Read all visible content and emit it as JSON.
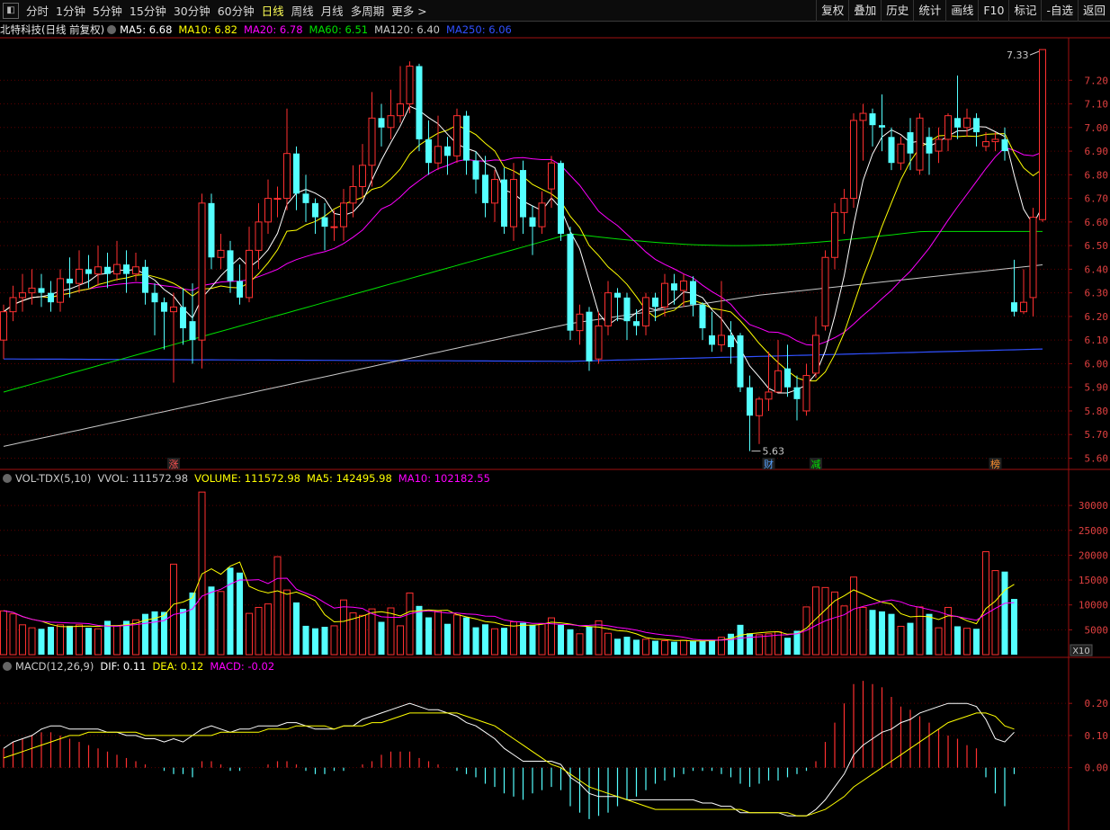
{
  "toolbar": {
    "timeframes": [
      "分时",
      "1分钟",
      "5分钟",
      "15分钟",
      "30分钟",
      "60分钟",
      "日线",
      "周线",
      "月线",
      "多周期",
      "更多 >"
    ],
    "active_index": 6,
    "tools": [
      "复权",
      "叠加",
      "历史",
      "统计",
      "画线",
      "F10",
      "标记",
      "-自选",
      "返回"
    ]
  },
  "legend": {
    "title": "北特科技(日线 前复权)",
    "items": [
      {
        "label": "MA5: 6.68",
        "color": "#ffffff"
      },
      {
        "label": "MA10: 6.82",
        "color": "#ffff00"
      },
      {
        "label": "MA20: 6.78",
        "color": "#ff00ff"
      },
      {
        "label": "MA60: 6.51",
        "color": "#00e000"
      },
      {
        "label": "MA120: 6.40",
        "color": "#c8c8c8"
      },
      {
        "label": "MA250: 6.06",
        "color": "#3050ff"
      }
    ]
  },
  "vol_legend": {
    "items": [
      {
        "label": "VOL-TDX(5,10)",
        "color": "#c8c8c8"
      },
      {
        "label": "VVOL: 111572.98",
        "color": "#c8c8c8"
      },
      {
        "label": "VOLUME: 111572.98",
        "color": "#ffff00"
      },
      {
        "label": "MA5: 142495.98",
        "color": "#ffff00"
      },
      {
        "label": "MA10: 102182.55",
        "color": "#ff00ff"
      }
    ],
    "unit_badge": "X10"
  },
  "macd_legend": {
    "items": [
      {
        "label": "MACD(12,26,9)",
        "color": "#c8c8c8"
      },
      {
        "label": "DIF: 0.11",
        "color": "#ffffff"
      },
      {
        "label": "DEA: 0.12",
        "color": "#ffff00"
      },
      {
        "label": "MACD: -0.02",
        "color": "#ff00ff"
      }
    ]
  },
  "annotations": {
    "high": "7.33",
    "low": "5.63",
    "events": [
      "涨",
      "财",
      "减",
      "榜"
    ]
  },
  "colors": {
    "up": "#ff3030",
    "down": "#54ffff",
    "axis": "#a01010",
    "grid": "#5a0000"
  },
  "chart_data": [
    {
      "type": "candlestick",
      "name": "price",
      "yticks": [
        7.2,
        7.1,
        7.0,
        6.9,
        6.8,
        6.7,
        6.6,
        6.5,
        6.4,
        6.3,
        6.2,
        6.1,
        6.0,
        5.9,
        5.8,
        5.7,
        5.6
      ],
      "ylim": [
        5.56,
        7.38
      ],
      "candles": [
        [
          6.1,
          6.22,
          6.25,
          6.02
        ],
        [
          6.22,
          6.28,
          6.33,
          6.18
        ],
        [
          6.28,
          6.3,
          6.38,
          6.22
        ],
        [
          6.3,
          6.32,
          6.4,
          6.25
        ],
        [
          6.32,
          6.3,
          6.38,
          6.24
        ],
        [
          6.3,
          6.26,
          6.35,
          6.22
        ],
        [
          6.26,
          6.36,
          6.4,
          6.22
        ],
        [
          6.36,
          6.34,
          6.45,
          6.28
        ],
        [
          6.34,
          6.4,
          6.48,
          6.3
        ],
        [
          6.4,
          6.38,
          6.46,
          6.32
        ],
        [
          6.38,
          6.41,
          6.5,
          6.33
        ],
        [
          6.41,
          6.38,
          6.47,
          6.32
        ],
        [
          6.38,
          6.42,
          6.52,
          6.35
        ],
        [
          6.42,
          6.38,
          6.48,
          6.3
        ],
        [
          6.38,
          6.41,
          6.47,
          6.35
        ],
        [
          6.41,
          6.3,
          6.44,
          6.25
        ],
        [
          6.3,
          6.26,
          6.34,
          6.12
        ],
        [
          6.26,
          6.22,
          6.28,
          6.06
        ],
        [
          6.22,
          6.24,
          6.3,
          5.92
        ],
        [
          6.24,
          6.15,
          6.32,
          6.08
        ],
        [
          6.18,
          6.1,
          6.34,
          6.0
        ],
        [
          6.1,
          6.68,
          6.72,
          5.98
        ],
        [
          6.68,
          6.45,
          6.72,
          6.4
        ],
        [
          6.45,
          6.48,
          6.55,
          6.4
        ],
        [
          6.48,
          6.35,
          6.52,
          6.3
        ],
        [
          6.35,
          6.28,
          6.42,
          6.25
        ],
        [
          6.28,
          6.48,
          6.58,
          6.26
        ],
        [
          6.48,
          6.6,
          6.68,
          6.4
        ],
        [
          6.6,
          6.7,
          6.78,
          6.55
        ],
        [
          6.7,
          6.7,
          6.75,
          6.62
        ],
        [
          6.7,
          6.89,
          7.08,
          6.65
        ],
        [
          6.89,
          6.72,
          6.92,
          6.65
        ],
        [
          6.72,
          6.68,
          6.8,
          6.6
        ],
        [
          6.68,
          6.62,
          6.7,
          6.55
        ],
        [
          6.62,
          6.58,
          6.68,
          6.48
        ],
        [
          6.58,
          6.58,
          6.65,
          6.52
        ],
        [
          6.58,
          6.68,
          6.74,
          6.52
        ],
        [
          6.68,
          6.75,
          6.84,
          6.62
        ],
        [
          6.75,
          6.84,
          6.93,
          6.7
        ],
        [
          6.84,
          7.04,
          7.15,
          6.75
        ],
        [
          7.04,
          7.0,
          7.1,
          6.92
        ],
        [
          7.0,
          7.05,
          7.16,
          6.95
        ],
        [
          7.05,
          7.1,
          7.26,
          7.02
        ],
        [
          7.1,
          7.26,
          7.28,
          7.06
        ],
        [
          7.26,
          6.95,
          7.27,
          6.9
        ],
        [
          6.95,
          6.85,
          7.03,
          6.8
        ],
        [
          6.85,
          6.92,
          7.05,
          6.82
        ],
        [
          6.92,
          6.88,
          6.96,
          6.8
        ],
        [
          6.88,
          7.05,
          7.08,
          6.85
        ],
        [
          7.05,
          6.86,
          7.07,
          6.8
        ],
        [
          6.86,
          6.78,
          6.9,
          6.72
        ],
        [
          6.8,
          6.68,
          6.88,
          6.62
        ],
        [
          6.68,
          6.78,
          6.82,
          6.6
        ],
        [
          6.78,
          6.58,
          6.83,
          6.55
        ],
        [
          6.58,
          6.78,
          6.85,
          6.52
        ],
        [
          6.82,
          6.62,
          6.86,
          6.55
        ],
        [
          6.62,
          6.58,
          6.67,
          6.46
        ],
        [
          6.58,
          6.68,
          6.73,
          6.55
        ],
        [
          6.74,
          6.85,
          6.88,
          6.66
        ],
        [
          6.85,
          6.55,
          6.86,
          6.52
        ],
        [
          6.55,
          6.14,
          6.58,
          6.1
        ],
        [
          6.14,
          6.21,
          6.25,
          6.08
        ],
        [
          6.22,
          6.01,
          6.24,
          5.97
        ],
        [
          6.02,
          6.16,
          6.22,
          6.0
        ],
        [
          6.16,
          6.3,
          6.35,
          6.12
        ],
        [
          6.3,
          6.28,
          6.32,
          6.18
        ],
        [
          6.28,
          6.18,
          6.3,
          6.1
        ],
        [
          6.18,
          6.16,
          6.23,
          6.12
        ],
        [
          6.16,
          6.28,
          6.3,
          6.12
        ],
        [
          6.28,
          6.24,
          6.3,
          6.18
        ],
        [
          6.24,
          6.34,
          6.38,
          6.2
        ],
        [
          6.34,
          6.31,
          6.38,
          6.25
        ],
        [
          6.31,
          6.35,
          6.38,
          6.24
        ],
        [
          6.35,
          6.25,
          6.37,
          6.2
        ],
        [
          6.25,
          6.15,
          6.26,
          6.1
        ],
        [
          6.12,
          6.08,
          6.22,
          6.05
        ],
        [
          6.08,
          6.12,
          6.35,
          6.05
        ],
        [
          6.12,
          6.07,
          6.18,
          6.0
        ],
        [
          6.12,
          5.9,
          6.13,
          5.88
        ],
        [
          5.9,
          5.78,
          5.95,
          5.63
        ],
        [
          5.78,
          5.85,
          5.86,
          5.66
        ],
        [
          5.85,
          5.88,
          6.05,
          5.8
        ],
        [
          5.88,
          5.97,
          6.1,
          5.88
        ],
        [
          5.98,
          5.9,
          6.08,
          5.86
        ],
        [
          5.9,
          5.85,
          5.95,
          5.76
        ],
        [
          5.8,
          5.95,
          6.0,
          5.78
        ],
        [
          5.96,
          6.12,
          6.2,
          5.94
        ],
        [
          6.16,
          6.45,
          6.48,
          6.14
        ],
        [
          6.45,
          6.64,
          6.68,
          6.4
        ],
        [
          6.64,
          6.7,
          6.74,
          6.55
        ],
        [
          6.7,
          7.03,
          7.06,
          6.66
        ],
        [
          7.03,
          7.06,
          7.1,
          6.86
        ],
        [
          7.06,
          7.01,
          7.08,
          6.92
        ],
        [
          7.01,
          7.0,
          7.14,
          6.9
        ],
        [
          6.96,
          6.85,
          7.0,
          6.82
        ],
        [
          6.85,
          6.93,
          6.96,
          6.82
        ],
        [
          6.98,
          6.89,
          7.04,
          6.82
        ],
        [
          6.82,
          7.04,
          7.06,
          6.8
        ],
        [
          6.96,
          6.89,
          7.0,
          6.8
        ],
        [
          6.9,
          6.95,
          7.0,
          6.85
        ],
        [
          6.95,
          7.05,
          7.06,
          6.9
        ],
        [
          7.04,
          7.0,
          7.22,
          6.95
        ],
        [
          7.0,
          7.04,
          7.08,
          6.96
        ],
        [
          7.04,
          6.98,
          7.06,
          6.92
        ],
        [
          6.92,
          6.94,
          6.98,
          6.9
        ],
        [
          6.94,
          6.95,
          6.98,
          6.9
        ],
        [
          6.95,
          6.9,
          7.0,
          6.86
        ],
        [
          6.26,
          6.22,
          6.44,
          6.2
        ],
        [
          6.22,
          6.26,
          6.4,
          6.21
        ],
        [
          6.28,
          6.62,
          6.66,
          6.2
        ],
        [
          6.61,
          7.33,
          7.33,
          6.6
        ]
      ]
    },
    {
      "type": "bar",
      "name": "volume",
      "unit": "x10",
      "yticks": [
        30000,
        25000,
        20000,
        15000,
        10000,
        5000
      ],
      "ylim": [
        0,
        34000
      ],
      "values": [
        8800,
        8200,
        6000,
        5400,
        5200,
        5600,
        6000,
        5800,
        6000,
        5400,
        5200,
        6800,
        5800,
        6800,
        7000,
        8200,
        8700,
        8600,
        18200,
        9200,
        12500,
        32700,
        13700,
        12700,
        17500,
        16500,
        8300,
        9500,
        10200,
        19700,
        13000,
        10500,
        5800,
        5300,
        5600,
        5800,
        11000,
        8400,
        7900,
        9200,
        6600,
        9400,
        5800,
        12400,
        9800,
        7500,
        8800,
        6200,
        8000,
        7500,
        5500,
        6100,
        5200,
        5400,
        6600,
        6400,
        6000,
        6200,
        7400,
        6000,
        5100,
        4200,
        5600,
        6800,
        4300,
        3200,
        3600,
        3000,
        3100,
        2800,
        2800,
        2600,
        2900,
        2700,
        2800,
        3000,
        3500,
        4200,
        6000,
        4300,
        4000,
        4200,
        4600,
        3400,
        4800,
        9600,
        13600,
        13500,
        12600,
        9800,
        15600,
        9500,
        9000,
        8700,
        8200,
        5700,
        6400,
        9600,
        8200,
        5400,
        9500,
        5700,
        5300,
        5200,
        20700,
        16900,
        16700,
        11200
      ]
    },
    {
      "type": "bar",
      "name": "MACD",
      "yticks": [
        0.2,
        0.1,
        0.0
      ],
      "ylim": [
        -0.18,
        0.29
      ],
      "values": [
        0.06,
        0.08,
        0.09,
        0.1,
        0.11,
        0.11,
        0.1,
        0.09,
        0.08,
        0.07,
        0.06,
        0.05,
        0.04,
        0.03,
        0.02,
        0.01,
        0.0,
        -0.01,
        -0.02,
        -0.02,
        -0.03,
        0.02,
        0.02,
        0.01,
        -0.01,
        -0.01,
        0.0,
        0.0,
        0.01,
        0.02,
        0.02,
        0.01,
        -0.01,
        -0.02,
        -0.02,
        -0.01,
        -0.01,
        0.0,
        0.01,
        0.02,
        0.04,
        0.05,
        0.05,
        0.05,
        0.03,
        0.02,
        0.01,
        0.0,
        -0.01,
        -0.02,
        -0.03,
        -0.05,
        -0.06,
        -0.08,
        -0.09,
        -0.1,
        -0.08,
        -0.07,
        -0.06,
        -0.07,
        -0.12,
        -0.14,
        -0.16,
        -0.15,
        -0.14,
        -0.12,
        -0.1,
        -0.09,
        -0.07,
        -0.05,
        -0.04,
        -0.03,
        -0.02,
        -0.01,
        -0.01,
        -0.01,
        -0.02,
        -0.03,
        -0.05,
        -0.06,
        -0.05,
        -0.04,
        -0.04,
        -0.03,
        -0.02,
        -0.01,
        0.02,
        0.08,
        0.14,
        0.2,
        0.26,
        0.27,
        0.26,
        0.25,
        0.22,
        0.19,
        0.18,
        0.16,
        0.14,
        0.12,
        0.1,
        0.09,
        0.07,
        0.06,
        -0.03,
        -0.08,
        -0.12,
        -0.02
      ],
      "dif": [
        0.06,
        0.08,
        0.09,
        0.1,
        0.12,
        0.13,
        0.13,
        0.12,
        0.12,
        0.12,
        0.12,
        0.11,
        0.11,
        0.1,
        0.1,
        0.09,
        0.09,
        0.08,
        0.09,
        0.08,
        0.1,
        0.12,
        0.13,
        0.12,
        0.11,
        0.12,
        0.12,
        0.13,
        0.13,
        0.13,
        0.14,
        0.14,
        0.13,
        0.12,
        0.12,
        0.12,
        0.13,
        0.13,
        0.15,
        0.16,
        0.17,
        0.18,
        0.19,
        0.2,
        0.19,
        0.18,
        0.18,
        0.17,
        0.16,
        0.14,
        0.13,
        0.11,
        0.09,
        0.06,
        0.04,
        0.02,
        0.02,
        0.02,
        0.02,
        0.01,
        -0.03,
        -0.05,
        -0.08,
        -0.09,
        -0.09,
        -0.09,
        -0.1,
        -0.1,
        -0.1,
        -0.1,
        -0.1,
        -0.1,
        -0.1,
        -0.1,
        -0.11,
        -0.11,
        -0.12,
        -0.12,
        -0.14,
        -0.14,
        -0.14,
        -0.14,
        -0.14,
        -0.15,
        -0.15,
        -0.15,
        -0.13,
        -0.1,
        -0.06,
        -0.02,
        0.04,
        0.07,
        0.09,
        0.11,
        0.12,
        0.14,
        0.15,
        0.17,
        0.18,
        0.19,
        0.2,
        0.2,
        0.2,
        0.19,
        0.15,
        0.09,
        0.08,
        0.11
      ],
      "dea": [
        0.03,
        0.04,
        0.05,
        0.06,
        0.07,
        0.08,
        0.09,
        0.1,
        0.1,
        0.11,
        0.11,
        0.11,
        0.11,
        0.11,
        0.11,
        0.1,
        0.1,
        0.1,
        0.1,
        0.1,
        0.1,
        0.1,
        0.1,
        0.11,
        0.11,
        0.11,
        0.11,
        0.11,
        0.12,
        0.12,
        0.12,
        0.13,
        0.13,
        0.13,
        0.13,
        0.12,
        0.13,
        0.13,
        0.13,
        0.14,
        0.14,
        0.15,
        0.16,
        0.17,
        0.17,
        0.17,
        0.17,
        0.17,
        0.17,
        0.16,
        0.15,
        0.14,
        0.13,
        0.11,
        0.09,
        0.07,
        0.05,
        0.03,
        0.01,
        0.0,
        -0.02,
        -0.04,
        -0.06,
        -0.07,
        -0.08,
        -0.09,
        -0.1,
        -0.11,
        -0.12,
        -0.13,
        -0.13,
        -0.13,
        -0.13,
        -0.13,
        -0.13,
        -0.13,
        -0.13,
        -0.13,
        -0.13,
        -0.14,
        -0.14,
        -0.14,
        -0.14,
        -0.14,
        -0.15,
        -0.15,
        -0.14,
        -0.13,
        -0.11,
        -0.09,
        -0.06,
        -0.04,
        -0.02,
        0.0,
        0.02,
        0.04,
        0.06,
        0.08,
        0.1,
        0.12,
        0.14,
        0.15,
        0.16,
        0.17,
        0.17,
        0.16,
        0.13,
        0.12
      ]
    }
  ]
}
